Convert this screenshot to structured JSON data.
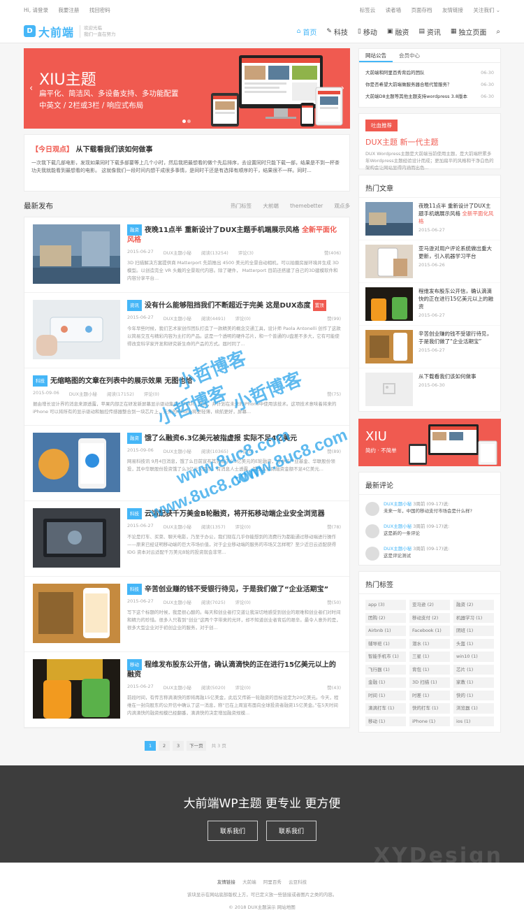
{
  "topbar": {
    "left": [
      "Hi, 请登录",
      "我要注册",
      "找回密码"
    ],
    "right": [
      "标签云",
      "读者墙",
      "页面存档",
      "友情链接",
      "关注我们 ⌄"
    ]
  },
  "header": {
    "logo_mark": "D",
    "logo_text": "大前端",
    "slogan_1": "欢迎光临",
    "slogan_2": "我们一直在努力",
    "nav": [
      {
        "label": "首页",
        "icon": "⌂"
      },
      {
        "label": "科技",
        "icon": "✎"
      },
      {
        "label": "移动",
        "icon": "▯"
      },
      {
        "label": "融资",
        "icon": "▣"
      },
      {
        "label": "资讯",
        "icon": "▤"
      },
      {
        "label": "独立页面",
        "icon": "▦"
      }
    ],
    "search_icon": "⌕"
  },
  "slider": {
    "title": "XIU主题",
    "line1": "扁平化、简洁风、多设备支持、多功能配置",
    "line2": "中英文 / 2栏或3栏 / 响应式布局",
    "prev": "‹",
    "next": "›"
  },
  "focus": {
    "tag": "【今日观点】",
    "title": "从下载看我们该如何做事",
    "desc": "一次我下载几部电影，发现如果同时下载多部要等上几个小时，然后我把最想看的做个先后排序，去设置同时只能下载一部，结果是不到一杯茶功夫我就能看到最想看的电影。 这就像我们一段时间内想干成很多事情，是同时干还是有选择有顺序的干，结果很不一样。同时..."
  },
  "latest": {
    "title": "最新发布",
    "links": [
      "热门标签",
      "大前端",
      "themebetter",
      "观点多"
    ]
  },
  "posts": [
    {
      "cat": "融资",
      "title": "夜晚11点半 重新设计了DUX主题手机端展示风格 ",
      "hl": "全新平面化风格",
      "date": "2015-06-27",
      "author": "DUX主题小秘",
      "views": "阅读(13254)",
      "comments": "评论(3)",
      "likes": "赞(406)",
      "desc": "3D 扫描解决方案提供商 Matterport 先前推出 4500 美元的全景自动相机，可以拍摄房屋环境并生成 3D模型。以创造完全 VR 头戴的全景现代内容。除了硬件， Matterport 目前还搭建了自己的3D建模软件和内容分享平台..."
    },
    {
      "cat": "资讯",
      "title": "没有什么能够阻挡我们不断超近于完美 这是DUX态度",
      "rec": "置顶",
      "date": "2015-06-27",
      "author": "DUX主题小秘",
      "views": "阅读(4491)",
      "comments": "评论(0)",
      "likes": "赞(99)",
      "desc": "今年早些时候，我们艺术家创作团队打造了一款精美的概念交通工具，设计师 Paola Antonelli 创作了这款以简易交互与精彩内容为主打的产品。这是一个透明的硬件芯片，和一个普通的U盘差不多大，它有可能使得改变科学家开发和研究新生命的产品的方式。届时同了..."
    },
    {
      "cat": "科技",
      "title": "无缩略图的文章在列表中的展示效果 无图也给",
      "date": "2015-09-06",
      "author": "DUX主题小秘",
      "views": "阅读(17152)",
      "comments": "评论(0)",
      "likes": "赞(75)",
      "desc": "据由增长设计界的消息来源透露，苹果内部正在研发新屏幕显示驱动集成（TDDI）技术，并计划在未来的iPhone中使用该技术。这项技术意味着将来的 iPhone 可以将所有的显示驱动和触控传感器整合到一块芯片上，未来的iPhone将更轻薄，续航更好，屏幕..."
    },
    {
      "cat": "融资",
      "title": "饿了么融资6.3亿美元被指虚报 实际不足4亿美元",
      "date": "2015-09-06",
      "author": "DUX主题小秘",
      "views": "阅读(10365)",
      "comments": "评论(0)",
      "likes": "赞(89)",
      "desc": "网易科技讯 9月4日消息，饿了么日前宣布其完成了6.3亿美元的E轮融资，由中信产业基金、华联股份领投，其中华联股份投资饿了么3亿元人民币。有消息人士透露，饿了么实际融资金额不足4亿美元..."
    },
    {
      "cat": "科技",
      "title": "云适配获千万美金B轮融资，将开拓移动端企业安全浏览器",
      "date": "2015-06-27",
      "author": "DUX主题小秘",
      "views": "阅读(1357)",
      "comments": "评论(0)",
      "likes": "赞(78)",
      "desc": "不论是打车、买菜、聊天电影，乃至于办公，我们现在几乎你能想到的消费行为都能通过移动端进行操作——原来已经证明移动端的巨大市场价值，对于企业移动端的服务的市场又怎样呢？至少近日云适配获得 IDG 资本对云适配千万美元B轮的投资就会非常..."
    },
    {
      "cat": "科技",
      "title": "辛苦创业赚的钱不受银行待见，于是我们做了“企业活期宝”",
      "date": "2015-06-27",
      "author": "DUX主题小秘",
      "views": "阅读(7025)",
      "comments": "评论(0)",
      "likes": "赞(50)",
      "desc": "写下这个标题的时候，我是很心酸的。每天和创业者打交道让我深切地感受到创业的艰难和创业者们对时间和精力的珍惜。很多人只看到“创业”这两个字带来的光环，却不知道创业者背后的艰辛。最令人意外的是，很多大型企业对于初创企业的服务，对于创..."
    },
    {
      "cat": "移动",
      "title": "程维发布股东公开信，确认滴滴快的正在进行15亿美元以上的融资",
      "date": "2015-06-27",
      "author": "DUX主题小秘",
      "views": "阅读(5020)",
      "comments": "评论(0)",
      "likes": "赞(43)",
      "desc": "前段时间，有传言称滴滴快的即将再融15亿美金，此后又传新一轮融资的目标设定为20亿美元。今天，程维在一封向股东的公开信中确认了这一消息，称“已在上周宣布面向全球投资者融资15亿美金。”在5天时间内滴滴快的融资规模已经翻番，滴滴快的决定增加融资规模..."
    }
  ],
  "pager": {
    "pages": [
      "1",
      "2",
      "3"
    ],
    "next": "下一页",
    "total": "共 3 页"
  },
  "sidebar": {
    "tabs": [
      "网站公告",
      "会员中心"
    ],
    "notices": [
      {
        "title": "大前端和阿里百秀背后的团队",
        "date": "06-30"
      },
      {
        "title": "你是否希望大前端做服务器合租代管服务？",
        "date": "06-30"
      },
      {
        "title": "大前端D8主题等其他主题支持wordpress 3.8版本",
        "date": "06-30"
      }
    ],
    "recommend": {
      "badge": "吐血推荐",
      "title": "DUX主题 新一代主题",
      "desc": "DUX Wordpress主题是大前端当前使用主题，是大前端积累多年Wordpress主题经验设计而成；更加扁平的风格和干净白色的架构会让网站显得内涵而出色..."
    },
    "hot_title": "热门文章",
    "hot": [
      {
        "title": "夜晚11点半 重新设计了DUX主题手机端展示风格 ",
        "hl": "全新平面化风格",
        "date": "2015-06-27"
      },
      {
        "title": "亚马逊对用户评论系统做出重大更新，引入机器学习平台",
        "date": "2015-06-26"
      },
      {
        "title": "程维发布股东公开信，确认滴滴快的正在进行15亿美元以上的融资",
        "date": "2015-06-27"
      },
      {
        "title": "辛苦创业赚的钱不受银行待见，于是我们做了“企业活期宝”",
        "date": "2015-06-27"
      },
      {
        "title": "从下载看我们该如何做事",
        "date": "2015-06-30"
      }
    ],
    "ad": {
      "title": "XIU",
      "sub": "简约 · 不简单"
    },
    "comments_title": "最新评论",
    "comments": [
      {
        "name": "DUX主题小秘",
        "time": "3周前 (09-17)说:",
        "text": "未来一年，中国的移动支付市场会是什么样?"
      },
      {
        "name": "DUX主题小秘",
        "time": "3周前 (09-17)说:",
        "text": "这是新的一条评论"
      },
      {
        "name": "DUX主题小秘",
        "time": "3周前 (09-17)说:",
        "text": "这是评论测试"
      }
    ],
    "tags_title": "热门标签",
    "tags": [
      "app (3)",
      "亚马逊 (2)",
      "融资 (2)",
      "团购 (2)",
      "移动支付 (2)",
      "机器学习 (1)",
      "Airbnb (1)",
      "Facebook (1)",
      "阴班 (1)",
      "辅导班 (1)",
      "潜水 (1)",
      "头盔 (1)",
      "智能手机市 (1)",
      "三星 (1)",
      "win10 (1)",
      "飞行器 (1)",
      "背包 (1)",
      "芯片 (1)",
      "金融 (1)",
      "3D 扫描 (1)",
      "家教 (1)",
      "时间 (1)",
      "时差 (1)",
      "快的 (1)",
      "滴滴打车 (1)",
      "快的打车 (1)",
      "浏览器 (1)",
      "移动 (1)",
      "iPhone (1)",
      "ios (1)"
    ]
  },
  "footer": {
    "slogan": "大前端WP主题 更专业 更方便",
    "btn1": "联系我们",
    "btn2": "联系我们",
    "big": "XYDesign",
    "links_label": "友情链接",
    "links": [
      "大前端",
      "阿里百秀",
      "云豆科技"
    ],
    "line2": "该块显示在网站底部版权上方，可已定义放一些链接或者图片之类的内容。",
    "line3": "© 2018 DUX主题演示   网站地图"
  },
  "watermark": {
    "a": "小哲博客",
    "b": "www.8uc8.com"
  },
  "colors": {
    "accent": "#45b6f7",
    "red": "#f05a50",
    "footer": "#3d3d3d"
  }
}
